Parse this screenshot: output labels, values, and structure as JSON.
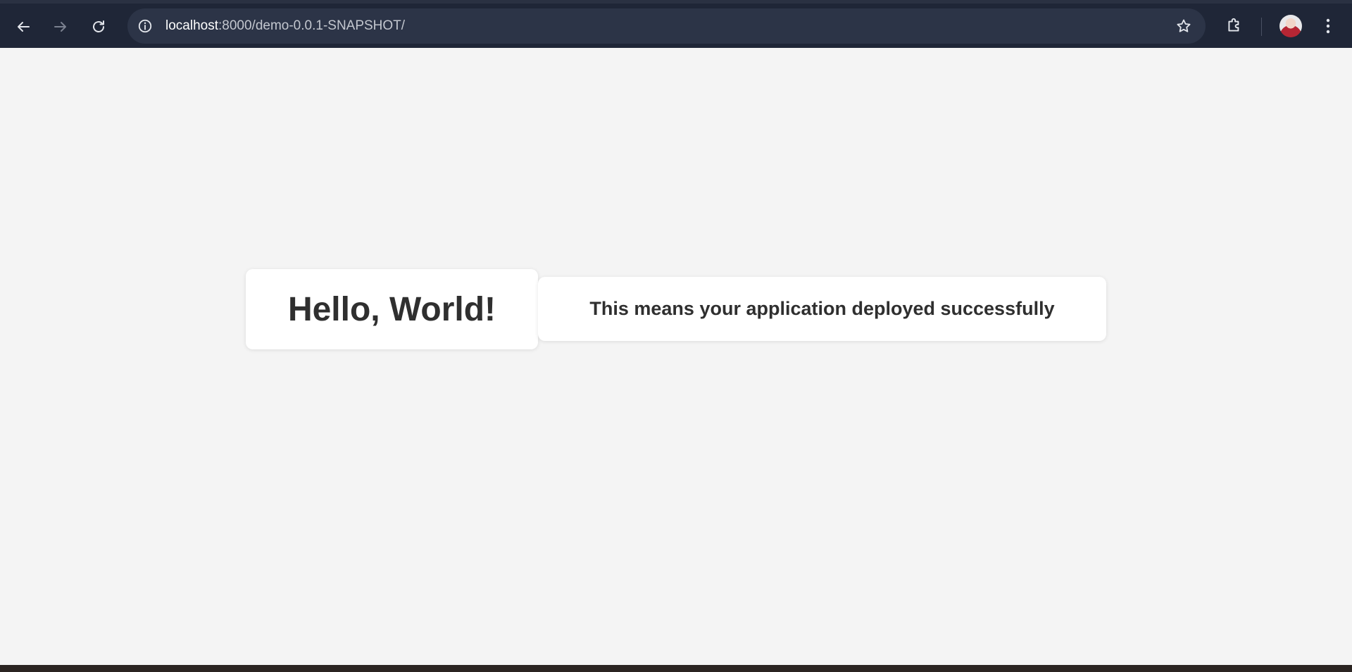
{
  "browser": {
    "url_host": "localhost",
    "url_rest": ":8000/demo-0.0.1-SNAPSHOT/",
    "icons": {
      "back": "arrow-left",
      "forward": "arrow-right",
      "reload": "reload",
      "site_info": "info-circle",
      "bookmark": "star-outline",
      "extensions": "puzzle-piece",
      "menu": "vertical-dots"
    },
    "colors": {
      "toolbar": "#1f2637",
      "omnibox": "#2c3447"
    }
  },
  "page": {
    "heading": "Hello, World!",
    "message": "This means your application deployed successfully",
    "colors": {
      "background": "#f4f4f4",
      "card": "#ffffff",
      "text": "#2f2f2f"
    }
  }
}
